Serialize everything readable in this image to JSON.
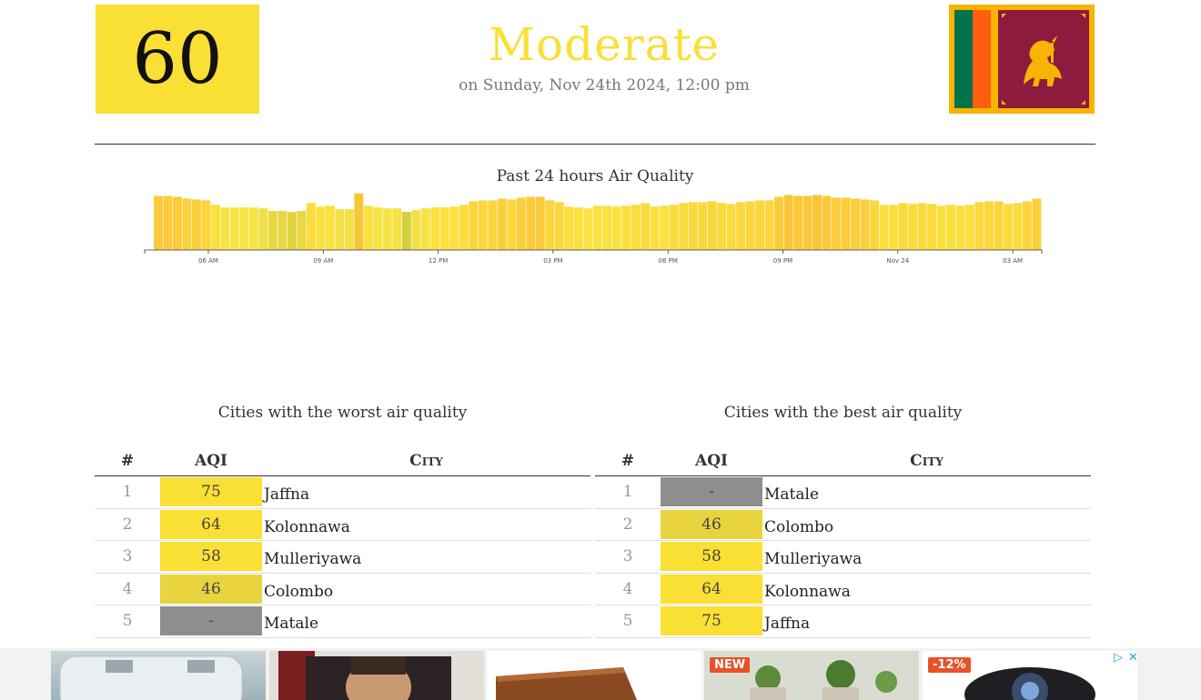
{
  "header": {
    "aqi_value": "60",
    "status": "Moderate",
    "date": "on Sunday, Nov 24th 2024, 12:00 pm",
    "status_color": "#fadf35"
  },
  "chart": {
    "title": "Past 24 hours Air Quality"
  },
  "chart_data": {
    "type": "bar",
    "title": "Past 24 hours Air Quality",
    "tick_labels": [
      "06 AM",
      "09 AM",
      "12 PM",
      "03 PM",
      "06 PM",
      "09 PM",
      "Nov 24",
      "03 AM"
    ],
    "values": [
      61,
      61,
      60,
      58,
      57,
      56,
      51,
      48,
      48,
      48,
      48,
      47,
      44,
      44,
      43,
      44,
      53,
      49,
      50,
      46,
      46,
      64,
      50,
      48,
      47,
      47,
      43,
      45,
      47,
      48,
      48,
      49,
      51,
      55,
      56,
      56,
      58,
      57,
      59,
      60,
      60,
      56,
      54,
      49,
      48,
      47,
      50,
      50,
      49,
      50,
      51,
      53,
      49,
      50,
      51,
      53,
      54,
      54,
      55,
      53,
      52,
      54,
      55,
      56,
      56,
      60,
      62,
      61,
      61,
      62,
      61,
      59,
      59,
      58,
      57,
      56,
      51,
      51,
      53,
      52,
      53,
      52,
      50,
      51,
      50,
      51,
      54,
      55,
      55,
      52,
      53,
      55,
      58
    ],
    "colors": [
      "#fbcb3b",
      "#fbcb3b",
      "#fbcb3b",
      "#fbd03c",
      "#fbd03c",
      "#fbd63d",
      "#fbe03f",
      "#f8e346",
      "#f8e346",
      "#f8e346",
      "#f8e346",
      "#f0e047",
      "#e8d844",
      "#e8d844",
      "#dfd440",
      "#e8d844",
      "#fbdc3e",
      "#fbe03f",
      "#fbe03f",
      "#f3e047",
      "#f3e047",
      "#fbc53a",
      "#fbe03f",
      "#f8e346",
      "#f8e346",
      "#f8e346",
      "#d4cf3c",
      "#f3e047",
      "#f8e346",
      "#fbe03f",
      "#fbe03f",
      "#fbe03f",
      "#fbdc3e",
      "#fbd63d",
      "#fbd63d",
      "#fbd63d",
      "#fbcf3b",
      "#fbd63d",
      "#fbcd3b",
      "#fbcb3b",
      "#fbcb3b",
      "#fbd63d",
      "#fbd83d",
      "#fbe03f",
      "#fbe03f",
      "#f8e346",
      "#fbe03f",
      "#fbe03f",
      "#fbe03f",
      "#fbe03f",
      "#fbdc3e",
      "#fbda3e",
      "#fbe03f",
      "#fbe03f",
      "#fbdc3e",
      "#fbda3e",
      "#fbd83d",
      "#fbd83d",
      "#fbd63d",
      "#fbda3e",
      "#fbda3e",
      "#fbd83d",
      "#fbd63d",
      "#fbd63d",
      "#fbd63d",
      "#fbcb3b",
      "#fbc539",
      "#fbc83a",
      "#fbc83a",
      "#fbc539",
      "#fbc83a",
      "#fbcd3b",
      "#fbcd3b",
      "#fbcf3b",
      "#fbd03c",
      "#fbd63d",
      "#fbe03f",
      "#fbe03f",
      "#fbda3e",
      "#fbdc3e",
      "#fbda3e",
      "#fbdc3e",
      "#fbe03f",
      "#fbe03f",
      "#fbe03f",
      "#fbe03f",
      "#fbd83d",
      "#fbd63d",
      "#fbd63d",
      "#fbdc3e",
      "#fbda3e",
      "#fbd63d",
      "#fbcf3b"
    ]
  },
  "worst": {
    "title": "Cities with the worst air quality",
    "headers": {
      "num": "#",
      "aqi": "AQI",
      "city": "City"
    },
    "rows": [
      {
        "num": "1",
        "aqi": "75",
        "city": "Jaffna",
        "color": "#fadf35"
      },
      {
        "num": "2",
        "aqi": "64",
        "city": "Kolonnawa",
        "color": "#fadf35"
      },
      {
        "num": "3",
        "aqi": "58",
        "city": "Mulleriyawa",
        "color": "#fadf35"
      },
      {
        "num": "4",
        "aqi": "46",
        "city": "Colombo",
        "color": "#e7d43e"
      },
      {
        "num": "5",
        "aqi": "-",
        "city": "Matale",
        "color": "#8e8e8e"
      }
    ]
  },
  "best": {
    "title": "Cities with the best air quality",
    "headers": {
      "num": "#",
      "aqi": "AQI",
      "city": "City"
    },
    "rows": [
      {
        "num": "1",
        "aqi": "-",
        "city": "Matale",
        "color": "#8e8e8e"
      },
      {
        "num": "2",
        "aqi": "46",
        "city": "Colombo",
        "color": "#e7d43e"
      },
      {
        "num": "3",
        "aqi": "58",
        "city": "Mulleriyawa",
        "color": "#fadf35"
      },
      {
        "num": "4",
        "aqi": "64",
        "city": "Kolonnawa",
        "color": "#fadf35"
      },
      {
        "num": "5",
        "aqi": "75",
        "city": "Jaffna",
        "color": "#fadf35"
      }
    ]
  },
  "ads": {
    "badge_new": "NEW",
    "badge_discount": "-12%"
  }
}
